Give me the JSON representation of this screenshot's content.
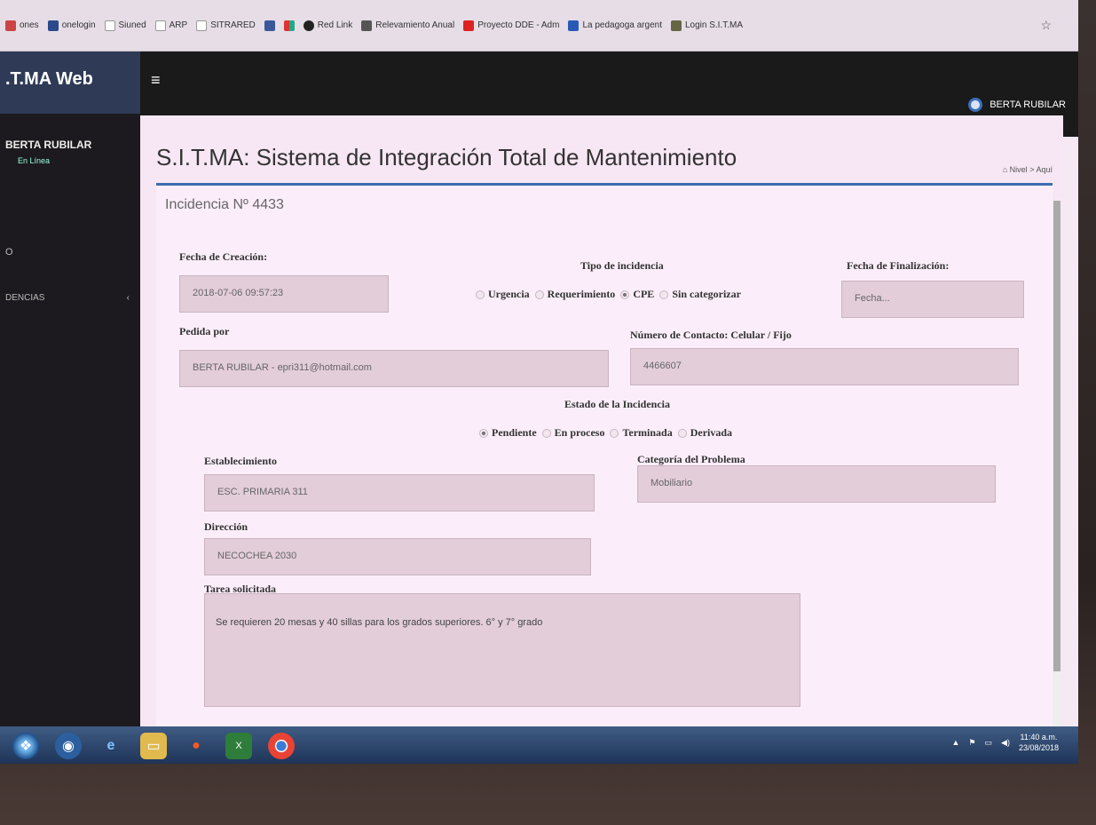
{
  "bookmarks": [
    {
      "label": "ones",
      "color": "#c44"
    },
    {
      "label": "onelogin",
      "color": "#2a4a8c"
    },
    {
      "label": "Siuned",
      "color": "#999"
    },
    {
      "label": "ARP",
      "color": "#999"
    },
    {
      "label": "SITRARED",
      "color": "#999"
    },
    {
      "label": "",
      "color": "#3b5998"
    },
    {
      "label": "",
      "color": "#d33"
    },
    {
      "label": "Red Link",
      "color": "#222"
    },
    {
      "label": "Relevamiento Anual",
      "color": "#555"
    },
    {
      "label": "Proyecto DDE - Adm",
      "color": "#d22"
    },
    {
      "label": "La pedagoga argent",
      "color": "#2a5ab8"
    },
    {
      "label": "Login S.I.T.MA",
      "color": "#664"
    }
  ],
  "sidebar": {
    "brand": ".T.MA Web",
    "user": "BERTA RUBILAR",
    "status": "En Línea",
    "item_a": "O",
    "item_b": "DENCIAS",
    "item_b_arrow": "‹"
  },
  "topbar": {
    "menu_icon": "≡",
    "user_name": "BERTA RUBILAR"
  },
  "page": {
    "title": "S.I.T.MA: Sistema de Integración Total de Mantenimiento",
    "crumb_home": "Nivel",
    "crumb_sep": ">",
    "crumb_here": "Aquí"
  },
  "incident": {
    "title": "Incidencia Nº 4433",
    "creation_label": "Fecha de Creación:",
    "creation_value": "2018-07-06 09:57:23",
    "type_label": "Tipo de incidencia",
    "type_options": [
      "Urgencia",
      "Requerimiento",
      "CPE",
      "Sin categorizar"
    ],
    "type_selected": "CPE",
    "end_label": "Fecha de Finalización:",
    "end_placeholder": "Fecha...",
    "requested_label": "Pedida por",
    "requested_value": "BERTA RUBILAR - epri311@hotmail.com",
    "contact_label": "Número de Contacto: Celular / Fijo",
    "contact_value": "4466607",
    "state_label": "Estado de la Incidencia",
    "state_options": [
      "Pendiente",
      "En proceso",
      "Terminada",
      "Derivada"
    ],
    "state_selected": "Pendiente",
    "establishment_label": "Establecimiento",
    "establishment_value": "ESC. PRIMARIA 311",
    "category_label": "Categoría del Problema",
    "category_value": "Mobiliario",
    "address_label": "Dirección",
    "address_value": "NECOCHEA 2030",
    "task_label": "Tarea solicitada",
    "task_value": "Se requieren 20 mesas y 40 sillas para los grados superiores. 6° y 7° grado"
  },
  "taskbar": {
    "clock_time": "11:40 a.m.",
    "clock_date": "23/08/2018"
  }
}
